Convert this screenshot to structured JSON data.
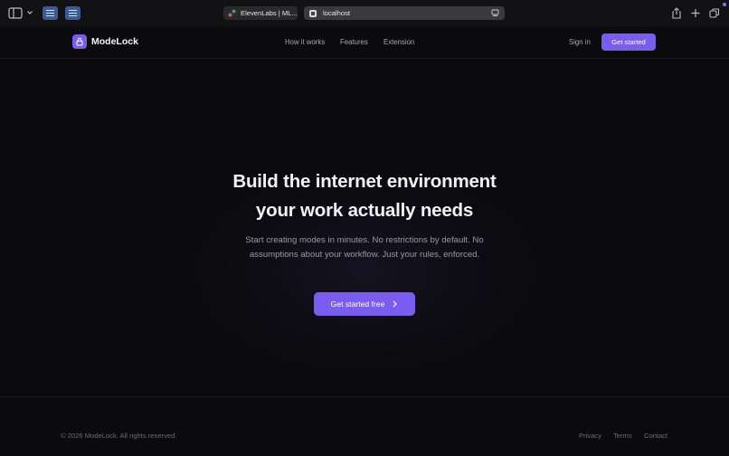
{
  "browser": {
    "tabs": [
      {
        "label": "ElevenLabs | ML..."
      },
      {
        "label": "localhost"
      }
    ],
    "url": "localhost"
  },
  "header": {
    "brand": "ModeLock",
    "nav": [
      "How it works",
      "Features",
      "Extension"
    ],
    "sign_in": "Sign in",
    "cta": "Get started"
  },
  "hero": {
    "title_line1": "Build the internet environment",
    "title_line2": "your work actually needs",
    "subtitle": "Start creating modes in minutes. No restrictions by default. No assumptions about your workflow. Just your rules, enforced.",
    "cta": "Get started free"
  },
  "footer": {
    "copyright": "© 2026 ModeLock. All rights reserved.",
    "links": [
      "Privacy",
      "Terms",
      "Contact"
    ]
  },
  "colors": {
    "background": "#0b0b0d",
    "accent": "#7b5cf0",
    "muted_text": "#9a9aa3"
  },
  "icons": [
    "sidebar-toggle-icon",
    "chevron-down-icon",
    "notes-tab-icon",
    "lock-icon",
    "reader-icon",
    "share-icon",
    "plus-icon",
    "tab-overview-icon",
    "chevron-right-icon"
  ]
}
